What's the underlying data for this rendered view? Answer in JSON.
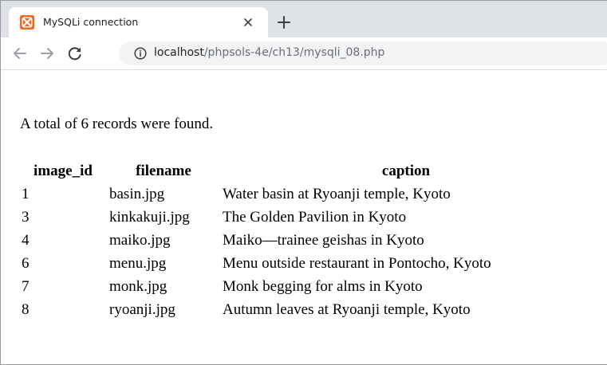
{
  "browser": {
    "tab": {
      "title": "MySQLi connection",
      "favicon": "xampp-favicon-icon",
      "close_icon": "close-icon"
    },
    "new_tab_icon": "plus-icon",
    "toolbar": {
      "back_icon": "back-arrow-icon",
      "forward_icon": "forward-arrow-icon",
      "reload_icon": "reload-icon",
      "site_info_icon": "info-icon",
      "url_host": "localhost",
      "url_path": "/phpsols-4e/ch13/mysqli_08.php"
    }
  },
  "page": {
    "summary": "A total of 6 records were found.",
    "table": {
      "headers": [
        "image_id",
        "filename",
        "caption"
      ],
      "rows": [
        [
          "1",
          "basin.jpg",
          "Water basin at Ryoanji temple, Kyoto"
        ],
        [
          "3",
          "kinkakuji.jpg",
          "The Golden Pavilion in Kyoto"
        ],
        [
          "4",
          "maiko.jpg",
          "Maiko—trainee geishas in Kyoto"
        ],
        [
          "6",
          "menu.jpg",
          "Menu outside restaurant in Pontocho, Kyoto"
        ],
        [
          "7",
          "monk.jpg",
          "Monk begging for alms in Kyoto"
        ],
        [
          "8",
          "ryoanji.jpg",
          "Autumn leaves at Ryoanji temple, Kyoto"
        ]
      ]
    }
  },
  "colors": {
    "tabstrip_bg": "#dee1e6",
    "favicon_bg": "#f4661e",
    "omnibox_bg": "#f1f3f4",
    "url_path_text": "#6b6e73"
  }
}
